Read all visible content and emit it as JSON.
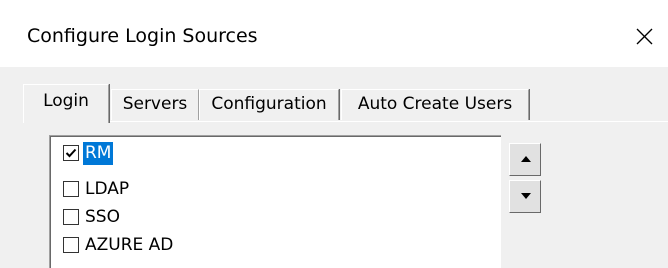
{
  "window": {
    "title": "Configure Login Sources"
  },
  "tabs": [
    {
      "label": "Login",
      "active": true
    },
    {
      "label": "Servers",
      "active": false
    },
    {
      "label": "Configuration",
      "active": false
    },
    {
      "label": "Auto Create Users",
      "active": false
    }
  ],
  "login_sources": [
    {
      "label": "RM",
      "checked": true,
      "selected": true
    },
    {
      "label": "LDAP",
      "checked": false,
      "selected": false
    },
    {
      "label": "SSO",
      "checked": false,
      "selected": false
    },
    {
      "label": "AZURE AD",
      "checked": false,
      "selected": false
    }
  ],
  "icons": {
    "close": "close-icon",
    "move_up": "arrow-up-icon",
    "move_down": "arrow-down-icon",
    "check": "checkmark-icon"
  },
  "colors": {
    "selection": "#0078d7",
    "dialog_bg": "#f0f0f0"
  }
}
